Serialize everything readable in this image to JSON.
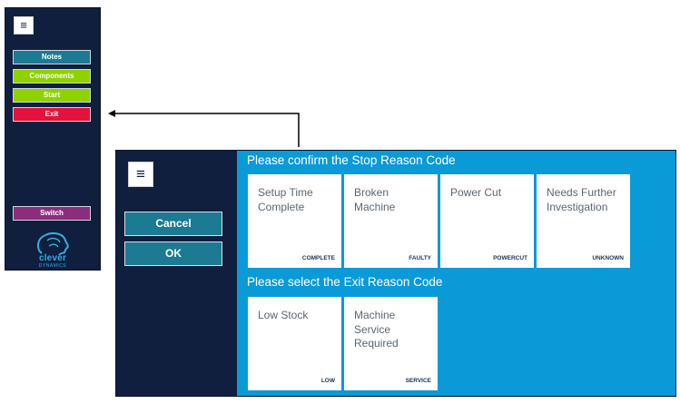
{
  "small_panel": {
    "buttons": {
      "notes": "Notes",
      "components": "Components",
      "start": "Start",
      "exit": "Exit",
      "switch": "Switch"
    },
    "logo": {
      "main": "clever",
      "sub": "DYNAMICS"
    }
  },
  "dialog": {
    "buttons": {
      "cancel": "Cancel",
      "ok": "OK"
    },
    "stop_section": {
      "title": "Please confirm the Stop Reason Code",
      "tiles": [
        {
          "label": "Setup Time Complete",
          "code": "COMPLETE"
        },
        {
          "label": "Broken Machine",
          "code": "FAULTY"
        },
        {
          "label": "Power Cut",
          "code": "POWERCUT"
        },
        {
          "label": "Needs Further Investigation",
          "code": "UNKNOWN"
        }
      ]
    },
    "exit_section": {
      "title": "Please select the Exit Reason Code",
      "tiles": [
        {
          "label": "Low Stock",
          "code": "LOW"
        },
        {
          "label": "Machine Service Required",
          "code": "SERVICE"
        }
      ]
    }
  },
  "colors": {
    "navy": "#0f1f3d",
    "teal": "#1c7a93",
    "green": "#8fd200",
    "red": "#e4123c",
    "purple": "#8b2d7c",
    "blue": "#0a9ad8"
  }
}
